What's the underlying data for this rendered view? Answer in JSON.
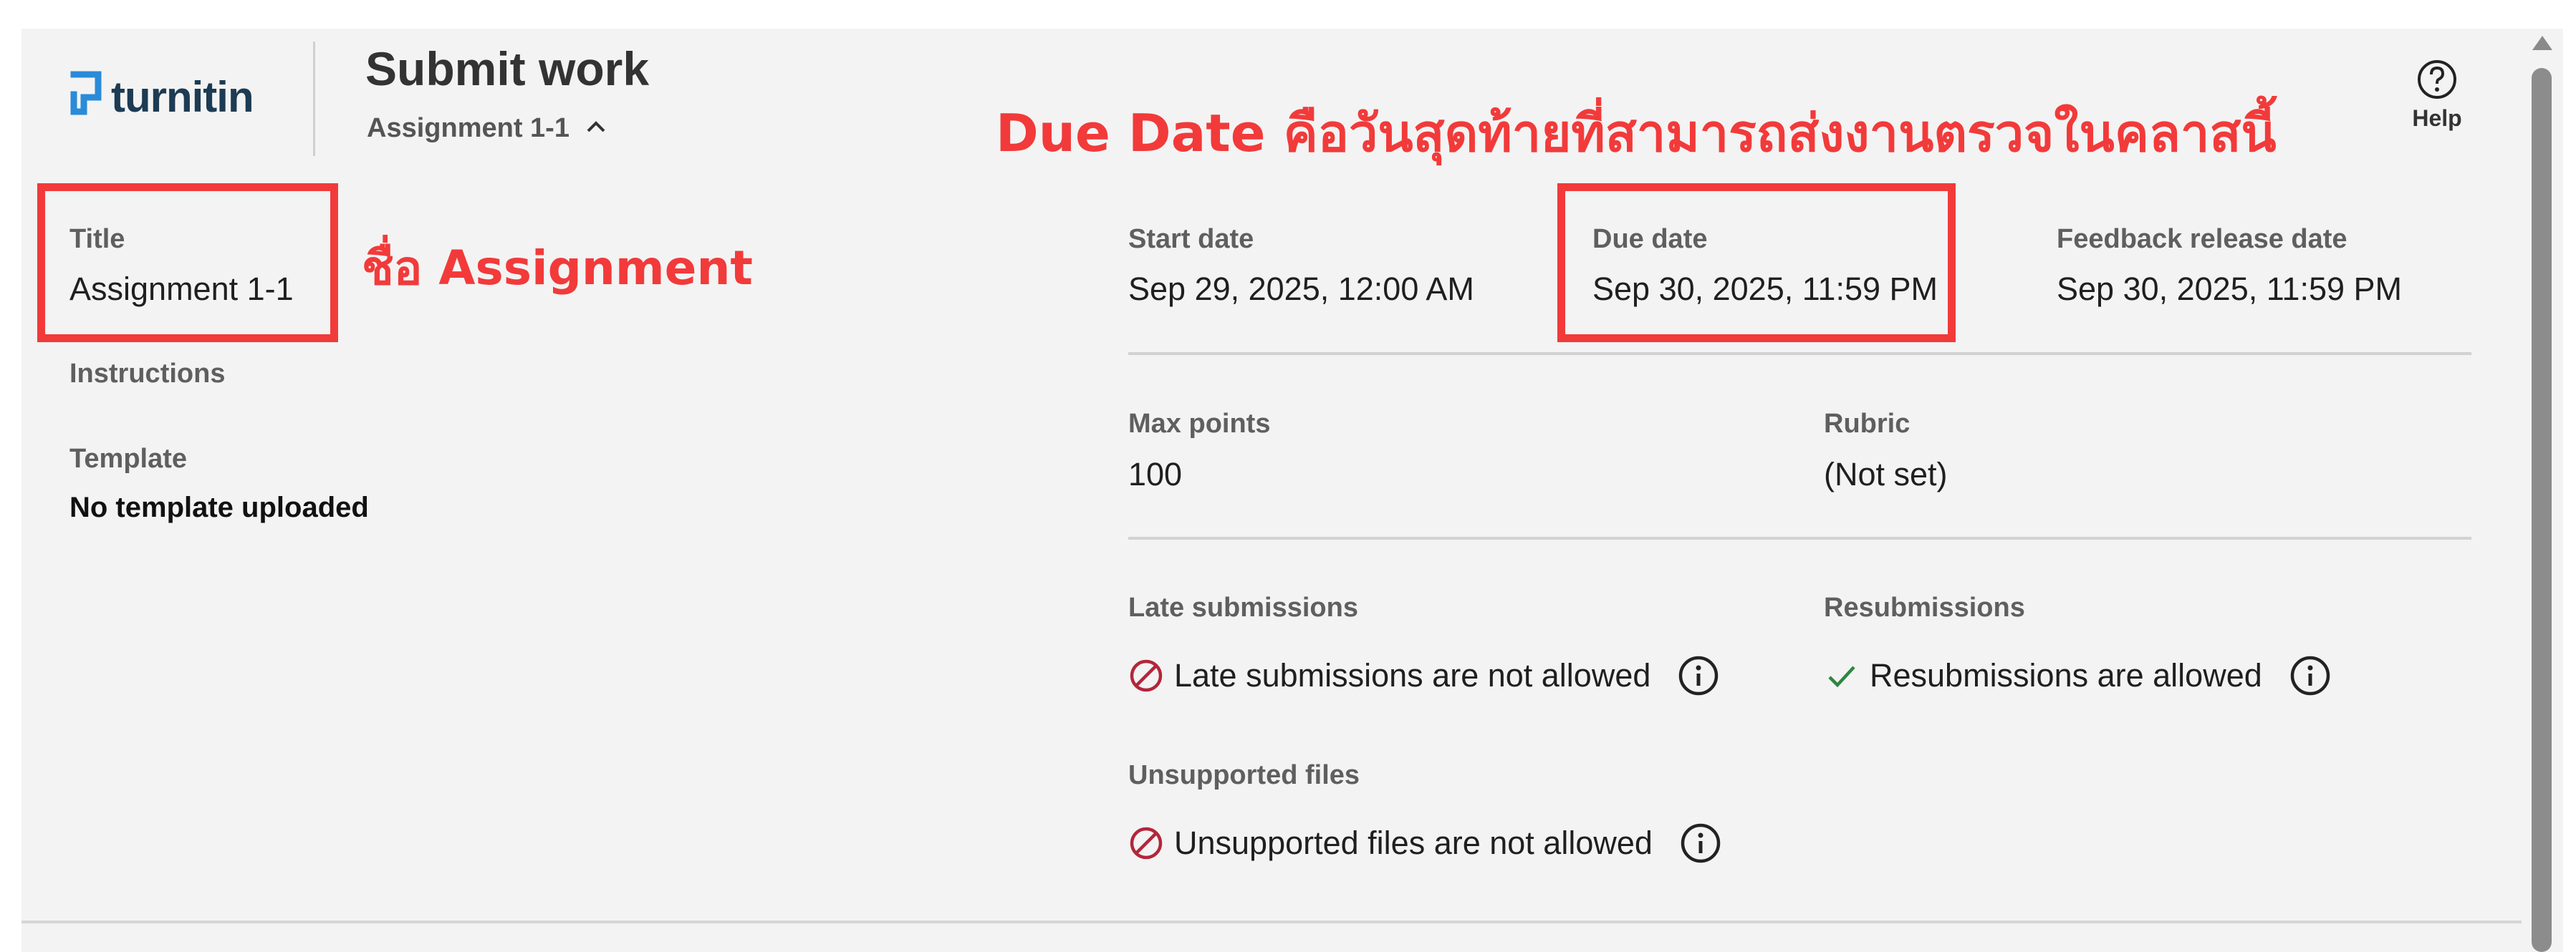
{
  "header": {
    "logo_text": "turnitin",
    "title": "Submit work",
    "assignment_toggle_label": "Assignment 1-1",
    "help_label": "Help"
  },
  "details": {
    "title_label": "Title",
    "title_value": "Assignment 1-1",
    "instructions_label": "Instructions",
    "template_label": "Template",
    "template_value": "No template uploaded"
  },
  "dates": {
    "start_label": "Start date",
    "start_value": "Sep 29, 2025, 12:00 AM",
    "due_label": "Due date",
    "due_value": "Sep 30, 2025, 11:59 PM",
    "feedback_label": "Feedback release date",
    "feedback_value": "Sep 30, 2025, 11:59 PM"
  },
  "grading": {
    "max_points_label": "Max points",
    "max_points_value": "100",
    "rubric_label": "Rubric",
    "rubric_value": "(Not set)"
  },
  "policies": {
    "late_label": "Late submissions",
    "late_value": "Late submissions are not allowed",
    "resub_label": "Resubmissions",
    "resub_value": "Resubmissions are allowed",
    "unsupported_label": "Unsupported files",
    "unsupported_value": "Unsupported files are not allowed"
  },
  "annotations": {
    "title_note": "ชื่อ Assignment",
    "due_note": "Due Date คือวันสุดท้ายที่สามารถส่งงานตรวจในคลาสนี้"
  },
  "colors": {
    "annotation": "#f23a3a",
    "brand": "#1d3b53",
    "logo_accent": "#2a8bd8",
    "deny": "#b3263a",
    "allow": "#2e8540"
  },
  "icons": {
    "logo": "turnitin-logo-icon",
    "help": "help-circle-icon",
    "chevron": "chevron-up-icon",
    "deny": "not-allowed-icon",
    "allow": "checkmark-icon",
    "info": "info-icon"
  }
}
